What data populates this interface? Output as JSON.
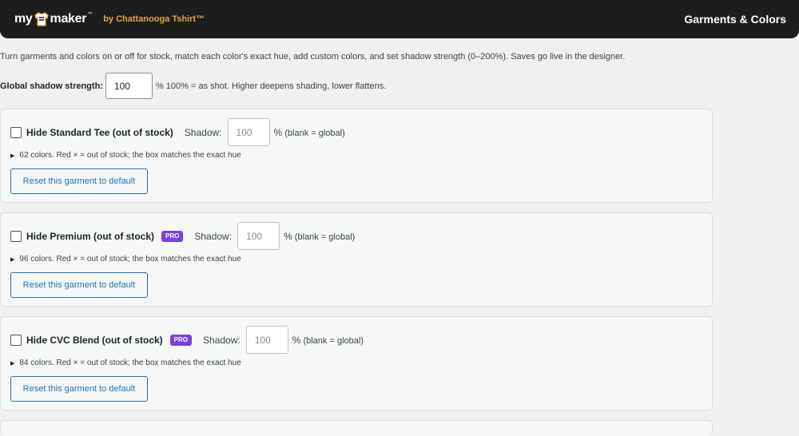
{
  "header": {
    "logo_left": "my",
    "logo_right": "maker",
    "logo_tm": "™",
    "tagline": "by Chattanooga Tshirt™",
    "title": "Garments & Colors"
  },
  "intro": "Turn garments and colors on or off for stock, match each color's exact hue, add custom colors, and set shadow strength (0–200%). Saves go live in the designer.",
  "global": {
    "label": "Global shadow strength:",
    "value": "100",
    "hint": "% 100% = as shot. Higher deepens shading, lower flattens."
  },
  "garments": [
    {
      "title": "Hide Standard Tee (out of stock)",
      "pro": false,
      "shadow_label": "Shadow:",
      "shadow_value": "100",
      "shadow_unit": "%",
      "shadow_hint": "(blank = global)",
      "meta": "62 colors. Red × = out of stock; the box matches the exact hue",
      "reset": "Reset this garment to default"
    },
    {
      "title": "Hide Premium (out of stock)",
      "pro": true,
      "pro_label": "PRO",
      "shadow_label": "Shadow:",
      "shadow_value": "100",
      "shadow_unit": "%",
      "shadow_hint": "(blank = global)",
      "meta": "96 colors. Red × = out of stock; the box matches the exact hue",
      "reset": "Reset this garment to default"
    },
    {
      "title": "Hide CVC Blend (out of stock)",
      "pro": true,
      "pro_label": "PRO",
      "shadow_label": "Shadow:",
      "shadow_value": "100",
      "shadow_unit": "%",
      "shadow_hint": "(blank = global)",
      "meta": "84 colors. Red × = out of stock; the box matches the exact hue",
      "reset": "Reset this garment to default"
    }
  ],
  "colors": {
    "header_bg": "#1d1d1f",
    "tagline": "#e0a83a",
    "accent": "#2271b1",
    "pro_badge": "#7b3fe4"
  }
}
